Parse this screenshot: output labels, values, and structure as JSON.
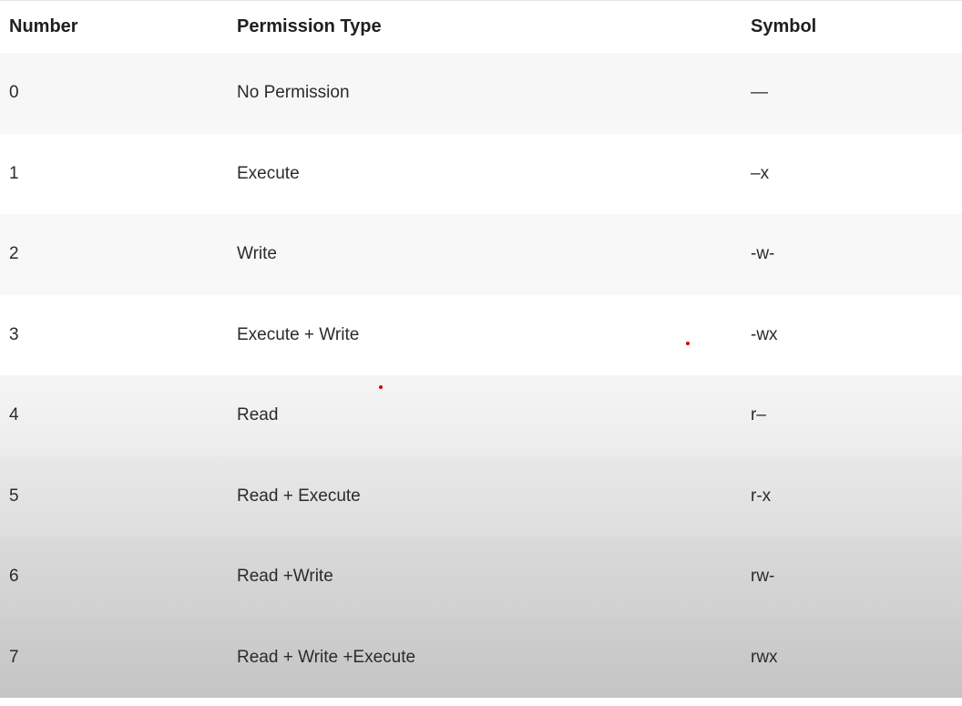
{
  "table": {
    "headers": {
      "number": "Number",
      "permission_type": "Permission Type",
      "symbol": "Symbol"
    },
    "rows": [
      {
        "number": "0",
        "permission_type": "No Permission",
        "symbol": "—"
      },
      {
        "number": "1",
        "permission_type": "Execute",
        "symbol": "–x"
      },
      {
        "number": "2",
        "permission_type": "Write",
        "symbol": "-w-"
      },
      {
        "number": "3",
        "permission_type": "Execute + Write",
        "symbol": "-wx"
      },
      {
        "number": "4",
        "permission_type": "Read",
        "symbol": "r–"
      },
      {
        "number": "5",
        "permission_type": "Read + Execute",
        "symbol": "r-x"
      },
      {
        "number": "6",
        "permission_type": "Read +Write",
        "symbol": "rw-"
      },
      {
        "number": "7",
        "permission_type": "Read + Write +Execute",
        "symbol": "rwx"
      }
    ]
  },
  "colors": {
    "text": "#2b2b2b",
    "marker": "#d40000"
  }
}
